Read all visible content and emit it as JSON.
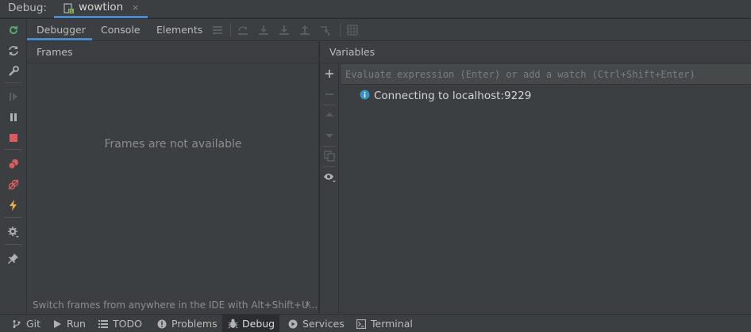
{
  "titlebar": {
    "label": "Debug:",
    "session_name": "wowtion",
    "session_icon": "nodejs-run-config-icon",
    "close_glyph": "×"
  },
  "toolbar_left": {
    "icons": [
      "rerun-icon",
      "restart-icon",
      "settings-wrench-icon",
      "resume-icon",
      "pause-icon",
      "stop-icon",
      "view-breakpoints-icon",
      "mute-breakpoints-icon",
      "get-thread-dump-icon",
      "settings-gear-icon",
      "pin-tab-icon"
    ]
  },
  "tabs": {
    "items": [
      "Debugger",
      "Console",
      "Elements"
    ],
    "active": "Debugger"
  },
  "tab_toolbar": {
    "icons": [
      "layout-menu-icon",
      "show-execution-point-icon",
      "step-over-icon",
      "step-into-icon",
      "step-out-icon",
      "run-to-cursor-icon",
      "evaluate-expression-icon"
    ]
  },
  "frames": {
    "title": "Frames",
    "empty_text": "Frames are not available",
    "hint": "Switch frames from anywhere in the IDE with Alt+Shift+U...",
    "hint_close": "×"
  },
  "variables": {
    "title": "Variables",
    "side_icons": [
      "add-watch-icon",
      "remove-watch-icon",
      "move-up-icon",
      "move-down-icon",
      "copy-icon",
      "watches-visibility-icon"
    ],
    "eval_placeholder": "Evaluate expression (Enter) or add a watch (Ctrl+Shift+Enter)",
    "status_icon": "info-icon",
    "status_text": "Connecting to localhost:9229"
  },
  "bottombar": {
    "items": [
      {
        "label": "Git",
        "icon": "git-branch-icon"
      },
      {
        "label": "Run",
        "icon": "run-icon"
      },
      {
        "label": "TODO",
        "icon": "todo-list-icon"
      },
      {
        "label": "Problems",
        "icon": "problems-icon"
      },
      {
        "label": "Debug",
        "icon": "debug-bug-icon"
      },
      {
        "label": "Services",
        "icon": "services-icon"
      },
      {
        "label": "Terminal",
        "icon": "terminal-icon"
      }
    ],
    "active": "Debug"
  },
  "colors": {
    "background": "#3c3f41",
    "accent": "#4a88c7",
    "green": "#59a869",
    "red": "#db5c5c",
    "yellow": "#f4af3d",
    "info_blue": "#3592c4"
  }
}
